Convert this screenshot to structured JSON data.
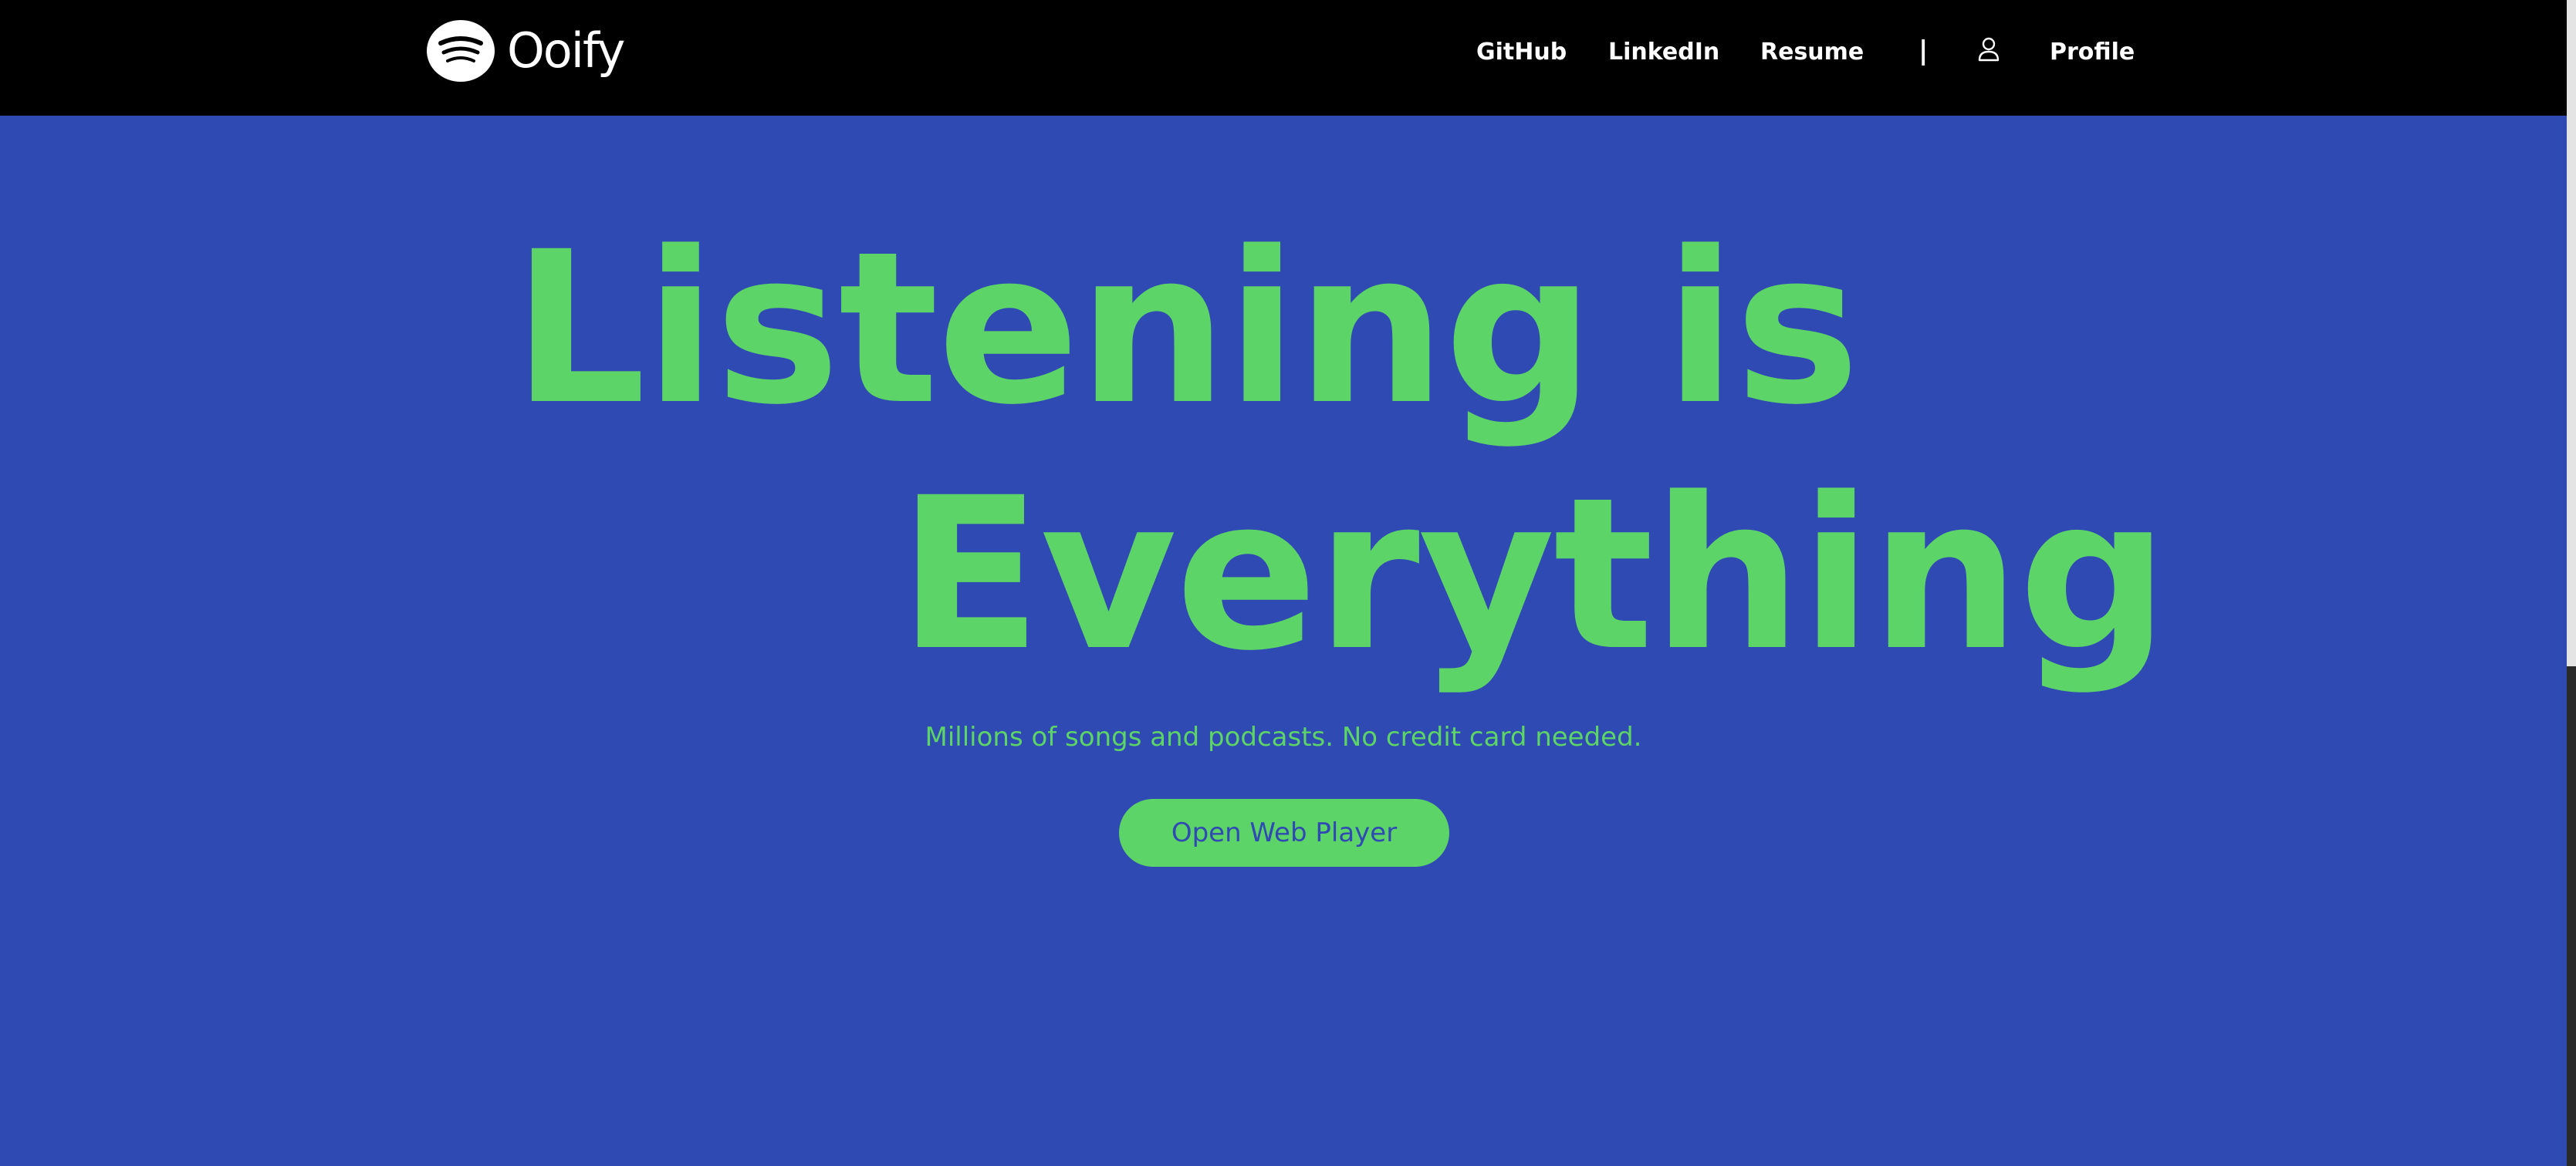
{
  "nav": {
    "brand": "Ooify",
    "links": [
      {
        "label": "GitHub"
      },
      {
        "label": "LinkedIn"
      },
      {
        "label": "Resume"
      }
    ],
    "divider": "|",
    "profile_icon": "user-icon",
    "profile_label": "Profile"
  },
  "hero": {
    "headline_line1": "Listening is",
    "headline_line2": "Everything",
    "tagline": "Millions of songs and podcasts. No credit card needed.",
    "cta_label": "Open Web Player"
  },
  "colors": {
    "navbar_bg": "#000000",
    "page_bg": "#2f4ab2",
    "accent_green": "#5dd467",
    "nav_text": "#ffffff"
  }
}
